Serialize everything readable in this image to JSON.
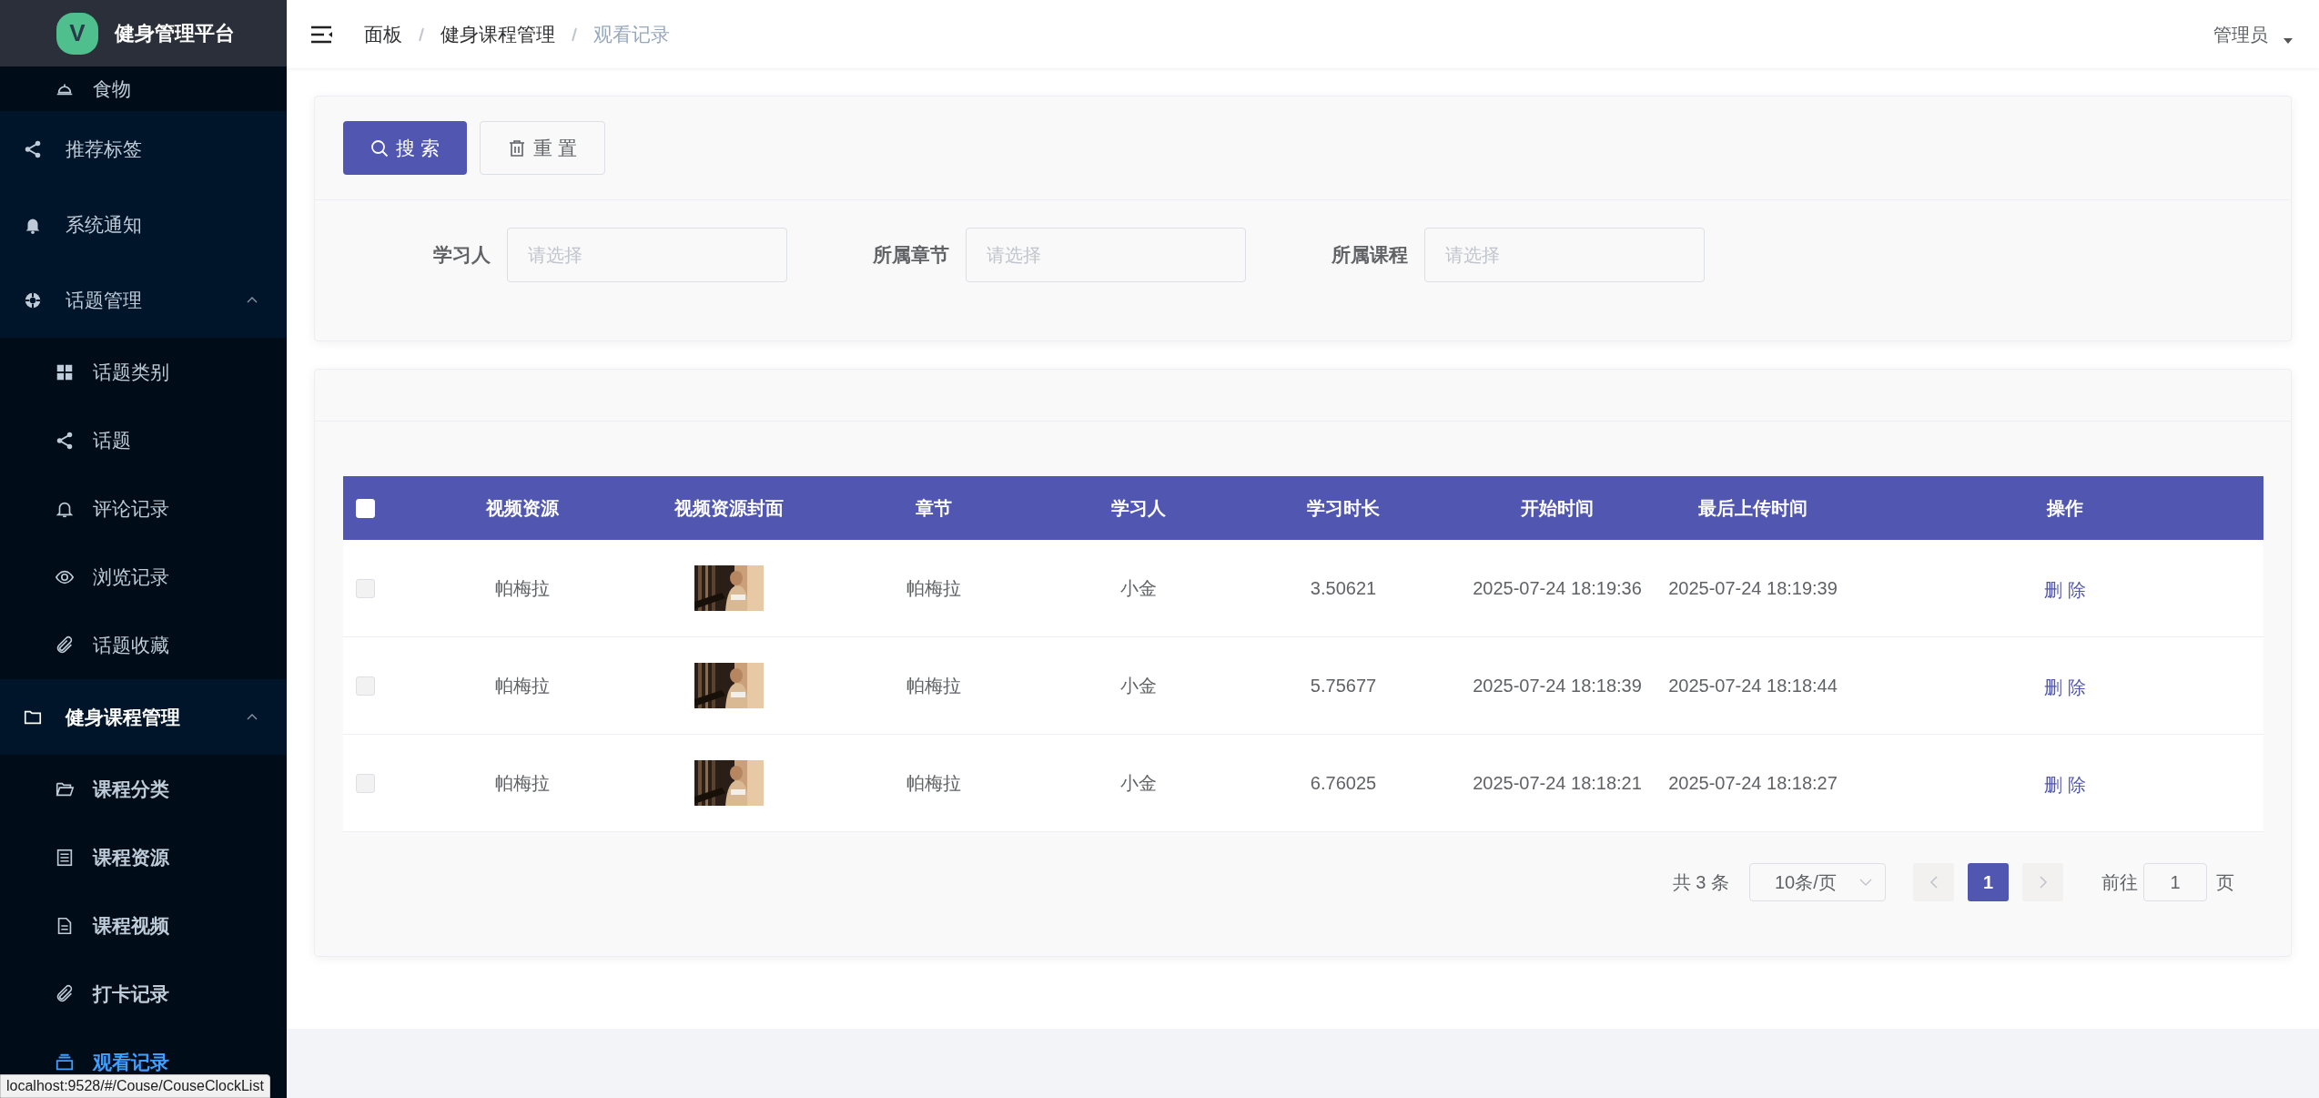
{
  "sidebar": {
    "logo_letter": "V",
    "title": "健身管理平台",
    "items": [
      {
        "label": "食物",
        "kind": "sub",
        "selected": false
      },
      {
        "label": "推荐标签",
        "kind": "item",
        "selected": false
      },
      {
        "label": "系统通知",
        "kind": "item",
        "selected": false
      },
      {
        "label": "话题管理",
        "kind": "group",
        "expanded": true,
        "active": false,
        "children": [
          {
            "label": "话题类别",
            "selected": false
          },
          {
            "label": "话题",
            "selected": false
          },
          {
            "label": "评论记录",
            "selected": false
          },
          {
            "label": "浏览记录",
            "selected": false
          },
          {
            "label": "话题收藏",
            "selected": false
          }
        ]
      },
      {
        "label": "健身课程管理",
        "kind": "group",
        "expanded": true,
        "active": true,
        "children": [
          {
            "label": "课程分类",
            "selected": false
          },
          {
            "label": "课程资源",
            "selected": false
          },
          {
            "label": "课程视频",
            "selected": false
          },
          {
            "label": "打卡记录",
            "selected": false
          },
          {
            "label": "观看记录",
            "selected": true
          }
        ]
      }
    ]
  },
  "header": {
    "breadcrumb": [
      "面板",
      "健身课程管理",
      "观看记录"
    ],
    "user": "管理员"
  },
  "search": {
    "buttons": [
      {
        "label": "搜 索",
        "kind": "primary"
      },
      {
        "label": "重 置",
        "kind": "plain"
      }
    ],
    "filters": [
      {
        "label": "学习人",
        "placeholder": "请选择"
      },
      {
        "label": "所属章节",
        "placeholder": "请选择"
      },
      {
        "label": "所属课程",
        "placeholder": "请选择"
      }
    ]
  },
  "table": {
    "select_all": {
      "checked": false
    },
    "columns": [
      "视频资源",
      "视频资源封面",
      "章节",
      "学习人",
      "学习时长",
      "开始时间",
      "最后上传时间",
      "操作"
    ],
    "rows": [
      {
        "checked": false,
        "video": "帕梅拉",
        "chapter": "帕梅拉",
        "learner": "小金",
        "duration": "3.50621",
        "start": "2025-07-24 18:19:36",
        "last_upload": "2025-07-24 18:19:39",
        "action": "删 除"
      },
      {
        "checked": false,
        "video": "帕梅拉",
        "chapter": "帕梅拉",
        "learner": "小金",
        "duration": "5.75677",
        "start": "2025-07-24 18:18:39",
        "last_upload": "2025-07-24 18:18:44",
        "action": "删 除"
      },
      {
        "checked": false,
        "video": "帕梅拉",
        "chapter": "帕梅拉",
        "learner": "小金",
        "duration": "6.76025",
        "start": "2025-07-24 18:18:21",
        "last_upload": "2025-07-24 18:18:27",
        "action": "删 除"
      }
    ]
  },
  "pagination": {
    "total": "共 3 条",
    "page_size": "10条/页",
    "pages": [
      {
        "label": "1",
        "selected": true
      }
    ],
    "jump_label": "前往",
    "jump_value": "1",
    "jump_suffix": "页"
  },
  "status_bar": "localhost:9528/#/Couse/CouseClockList"
}
